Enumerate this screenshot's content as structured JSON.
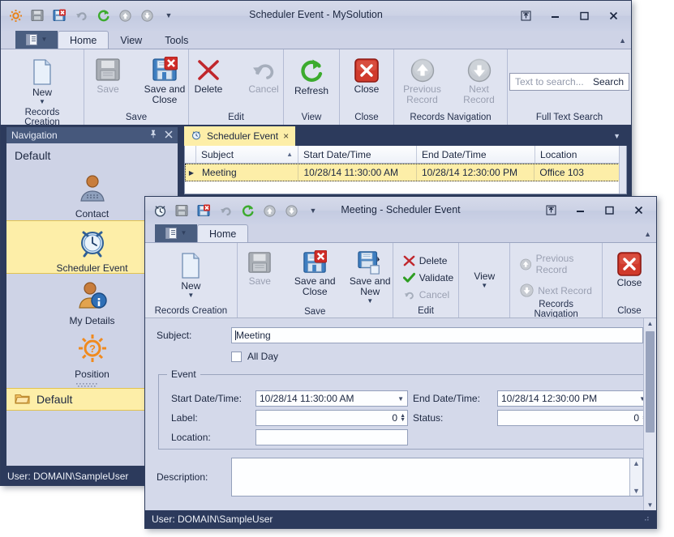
{
  "main_window": {
    "title": "Scheduler Event - MySolution",
    "quick_access": [
      {
        "name": "app-settings-icon",
        "glyph": "gear"
      },
      {
        "name": "save-icon",
        "glyph": "floppy"
      },
      {
        "name": "save-and-close-icon",
        "glyph": "floppy-x"
      },
      {
        "name": "undo-icon",
        "glyph": "undo"
      },
      {
        "name": "refresh-icon",
        "glyph": "refresh"
      },
      {
        "name": "previous-record-icon",
        "glyph": "up"
      },
      {
        "name": "next-record-icon",
        "glyph": "down"
      },
      {
        "name": "customize-icon",
        "glyph": "chevron-down"
      }
    ],
    "window_buttons": {
      "restore_up": "restore-up",
      "minimize": "minimize",
      "maximize": "maximize",
      "close": "close"
    },
    "tabs": [
      {
        "label": "Home",
        "active": true
      },
      {
        "label": "View",
        "active": false
      },
      {
        "label": "Tools",
        "active": false
      }
    ],
    "ribbon_groups": [
      {
        "name": "Records Creation",
        "buttons": [
          {
            "label": "New",
            "icon": "new-document-icon",
            "enabled": true,
            "dropdown": true
          }
        ]
      },
      {
        "name": "Save",
        "buttons": [
          {
            "label": "Save",
            "icon": "floppy-icon",
            "enabled": false,
            "dropdown": false
          },
          {
            "label": "Save and Close",
            "icon": "floppy-x-icon",
            "enabled": true,
            "dropdown": false
          }
        ]
      },
      {
        "name": "Edit",
        "buttons": [
          {
            "label": "Delete",
            "icon": "red-x-icon",
            "enabled": true,
            "dropdown": false
          },
          {
            "label": "Cancel",
            "icon": "undo-icon",
            "enabled": false,
            "dropdown": false
          }
        ]
      },
      {
        "name": "View",
        "buttons": [
          {
            "label": "Refresh",
            "icon": "refresh-icon",
            "enabled": true,
            "dropdown": false
          }
        ]
      },
      {
        "name": "Close",
        "buttons": [
          {
            "label": "Close",
            "icon": "close-red-icon",
            "enabled": true,
            "dropdown": false
          }
        ]
      },
      {
        "name": "Records Navigation",
        "buttons": [
          {
            "label": "Previous Record",
            "icon": "up-arrow-icon",
            "enabled": false,
            "dropdown": false
          },
          {
            "label": "Next Record",
            "icon": "down-arrow-icon",
            "enabled": false,
            "dropdown": false
          }
        ]
      },
      {
        "name": "Full Text Search",
        "search": {
          "placeholder": "Text to search...",
          "value": "",
          "button_label": "Search"
        }
      }
    ],
    "navigation": {
      "header_title": "Navigation",
      "header_buttons": {
        "pin": "pin-icon",
        "close": "close-icon"
      },
      "group_title": "Default",
      "items": [
        {
          "label": "Contact",
          "icon": "contact-icon",
          "selected": false
        },
        {
          "label": "Scheduler Event",
          "icon": "alarm-clock-icon",
          "selected": true
        },
        {
          "label": "My Details",
          "icon": "my-details-icon",
          "selected": false
        },
        {
          "label": "Position",
          "icon": "gear-question-icon",
          "selected": false
        }
      ],
      "folder": {
        "label": "Default",
        "icon": "folder-icon",
        "selected": true
      }
    },
    "document_tab": {
      "label": "Scheduler Event",
      "icon": "alarm-clock-icon",
      "close": "×"
    },
    "grid": {
      "columns": [
        "Subject",
        "Start Date/Time",
        "End Date/Time",
        "Location"
      ],
      "sort_column": "Subject",
      "sort_direction": "asc",
      "rows": [
        {
          "Subject": "Meeting",
          "Start Date/Time": "10/28/14 11:30:00 AM",
          "End Date/Time": "10/28/14 12:30:00 PM",
          "Location": "Office 103"
        }
      ]
    },
    "status_bar": {
      "text": "User: DOMAIN\\SampleUser"
    }
  },
  "dialog": {
    "title": "Meeting - Scheduler Event",
    "quick_access": [
      {
        "name": "alarm-clock-icon",
        "glyph": "clock"
      },
      {
        "name": "save-icon",
        "glyph": "floppy"
      },
      {
        "name": "save-and-close-icon",
        "glyph": "floppy-x"
      },
      {
        "name": "undo-icon",
        "glyph": "undo"
      },
      {
        "name": "refresh-icon",
        "glyph": "refresh"
      },
      {
        "name": "previous-record-icon",
        "glyph": "up"
      },
      {
        "name": "next-record-icon",
        "glyph": "down"
      },
      {
        "name": "customize-icon",
        "glyph": "chevron-down"
      }
    ],
    "tabs": [
      {
        "label": "Home",
        "active": true
      }
    ],
    "ribbon_groups": [
      {
        "name": "Records Creation",
        "buttons": [
          {
            "label": "New",
            "icon": "new-document-icon",
            "enabled": true,
            "dropdown": true
          }
        ]
      },
      {
        "name": "Save",
        "buttons": [
          {
            "label": "Save",
            "icon": "floppy-icon",
            "enabled": false,
            "dropdown": false
          },
          {
            "label": "Save and Close",
            "icon": "floppy-x-icon",
            "enabled": true,
            "dropdown": false
          },
          {
            "label": "Save and New",
            "icon": "floppy-new-icon",
            "enabled": true,
            "dropdown": true
          }
        ]
      },
      {
        "name": "Edit",
        "buttons": [
          {
            "label": "Delete",
            "icon": "red-x-icon",
            "enabled": true
          },
          {
            "label": "Validate",
            "icon": "green-check-icon",
            "enabled": true
          },
          {
            "label": "Cancel",
            "icon": "undo-icon",
            "enabled": false
          }
        ]
      },
      {
        "name": "",
        "buttons": [
          {
            "label": "View",
            "icon": "view-icon",
            "enabled": true,
            "dropdown": true
          }
        ]
      },
      {
        "name": "Records Navigation",
        "buttons": [
          {
            "label": "Previous Record",
            "icon": "up-arrow-icon",
            "enabled": false
          },
          {
            "label": "Next Record",
            "icon": "down-arrow-icon",
            "enabled": false
          }
        ]
      },
      {
        "name": "Close",
        "buttons": [
          {
            "label": "Close",
            "icon": "close-red-icon",
            "enabled": true
          }
        ]
      }
    ],
    "form": {
      "subject": {
        "label": "Subject:",
        "value": "Meeting"
      },
      "all_day": {
        "label": "All Day",
        "checked": false
      },
      "event_group": {
        "title": "Event",
        "start": {
          "label": "Start Date/Time:",
          "value": "10/28/14 11:30:00 AM"
        },
        "end": {
          "label": "End Date/Time:",
          "value": "10/28/14 12:30:00 PM"
        },
        "label_field": {
          "label": "Label:",
          "value": "0"
        },
        "status_field": {
          "label": "Status:",
          "value": "0"
        },
        "location": {
          "label": "Location:",
          "value": ""
        }
      },
      "description": {
        "label": "Description:",
        "value": ""
      }
    },
    "status_bar": {
      "text": "User: DOMAIN\\SampleUser"
    }
  },
  "icons": {
    "pin": "⚐",
    "close_x": "✕",
    "chevron_down": "▼",
    "chevron_up": "▲",
    "triangle_right": "▶",
    "sort_asc": "▲",
    "minimize": "—",
    "maximize": "☐",
    "restore_up": "⤒"
  }
}
